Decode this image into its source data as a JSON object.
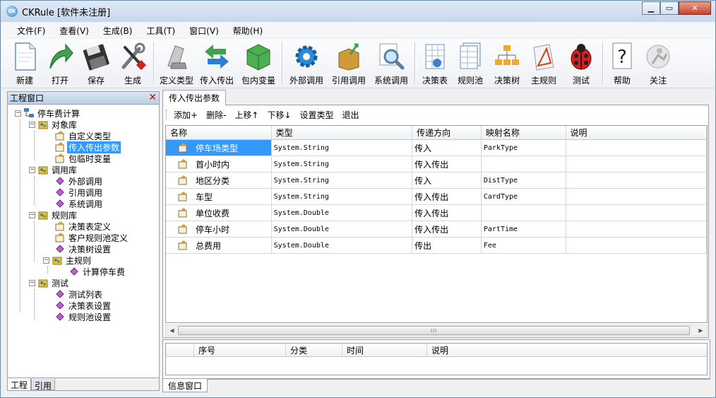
{
  "window": {
    "title": "CKRule [软件未注册]",
    "app_icon": "ck-logo-icon",
    "controls": [
      "minimize",
      "maximize",
      "close"
    ]
  },
  "menu": [
    "文件(F)",
    "查看(V)",
    "生成(B)",
    "工具(T)",
    "窗口(V)",
    "帮助(H)"
  ],
  "toolbar": [
    {
      "label": "新建",
      "icon": "new-document-icon"
    },
    {
      "label": "打开",
      "icon": "open-arrow-icon"
    },
    {
      "label": "保存",
      "icon": "floppy-disk-icon"
    },
    {
      "label": "生成",
      "icon": "tools-icon"
    },
    {
      "label": "定义类型",
      "icon": "define-type-icon"
    },
    {
      "label": "传入传出",
      "icon": "in-out-arrows-icon"
    },
    {
      "label": "包内变量",
      "icon": "package-icon"
    },
    {
      "label": "外部调用",
      "icon": "gear-icon"
    },
    {
      "label": "引用调用",
      "icon": "reference-box-icon"
    },
    {
      "label": "系统调用",
      "icon": "magnifier-icon"
    },
    {
      "label": "决策表",
      "icon": "decision-table-icon"
    },
    {
      "label": "规则池",
      "icon": "rule-pool-icon"
    },
    {
      "label": "决策树",
      "icon": "decision-tree-icon"
    },
    {
      "label": "主规则",
      "icon": "main-rule-icon"
    },
    {
      "label": "测试",
      "icon": "ladybug-icon"
    },
    {
      "label": "帮助",
      "icon": "help-icon"
    },
    {
      "label": "关注",
      "icon": "follow-icon"
    }
  ],
  "project_pane": {
    "title": "工程窗口",
    "tree": [
      {
        "label": "停车费计算",
        "icon": "project-icon"
      },
      {
        "label": "对象库",
        "icon": "library-icon"
      },
      {
        "label": "自定义类型",
        "icon": "class-icon"
      },
      {
        "label": "传入传出参数",
        "icon": "class-icon"
      },
      {
        "label": "包临时变量",
        "icon": "class-icon"
      },
      {
        "label": "调用库",
        "icon": "library-icon"
      },
      {
        "label": "外部调用",
        "icon": "method-icon"
      },
      {
        "label": "引用调用",
        "icon": "method-icon"
      },
      {
        "label": "系统调用",
        "icon": "method-icon"
      },
      {
        "label": "规则库",
        "icon": "library-icon"
      },
      {
        "label": "决策表定义",
        "icon": "class-icon"
      },
      {
        "label": "客户规则池定义",
        "icon": "class-icon"
      },
      {
        "label": "决策树设置",
        "icon": "method-icon"
      },
      {
        "label": "主规则",
        "icon": "library-icon"
      },
      {
        "label": "计算停车费",
        "icon": "method-icon"
      },
      {
        "label": "测试",
        "icon": "library-icon"
      },
      {
        "label": "测试列表",
        "icon": "method-icon"
      },
      {
        "label": "决策表设置",
        "icon": "method-icon"
      },
      {
        "label": "规则池设置",
        "icon": "method-icon"
      }
    ],
    "tabs": [
      "工程",
      "引用"
    ]
  },
  "document": {
    "tab": "传入传出参数",
    "actions": [
      "添加+",
      "删除-",
      "上移↑",
      "下移↓",
      "设置类型",
      "退出"
    ],
    "columns": [
      "名称",
      "类型",
      "传递方向",
      "映射名称",
      "说明"
    ],
    "rows": [
      {
        "name": "停车场类型",
        "type": "System.String",
        "direction": "传入",
        "map": "ParkType",
        "desc": ""
      },
      {
        "name": "首小时内",
        "type": "System.String",
        "direction": "传入传出",
        "map": "",
        "desc": ""
      },
      {
        "name": "地区分类",
        "type": "System.String",
        "direction": "传入",
        "map": "DistType",
        "desc": ""
      },
      {
        "name": "车型",
        "type": "System.String",
        "direction": "传入传出",
        "map": "CardType",
        "desc": ""
      },
      {
        "name": "单位收费",
        "type": "System.Double",
        "direction": "传入传出",
        "map": "",
        "desc": ""
      },
      {
        "name": "停车小时",
        "type": "System.Double",
        "direction": "传入传出",
        "map": "PartTime",
        "desc": ""
      },
      {
        "name": "总费用",
        "type": "System.Double",
        "direction": "传出",
        "map": "Fee",
        "desc": ""
      }
    ],
    "scroll_thumb_grip": "III"
  },
  "info_pane": {
    "columns": [
      "序号",
      "分类",
      "时间",
      "说明"
    ],
    "tab": "信息窗口"
  }
}
